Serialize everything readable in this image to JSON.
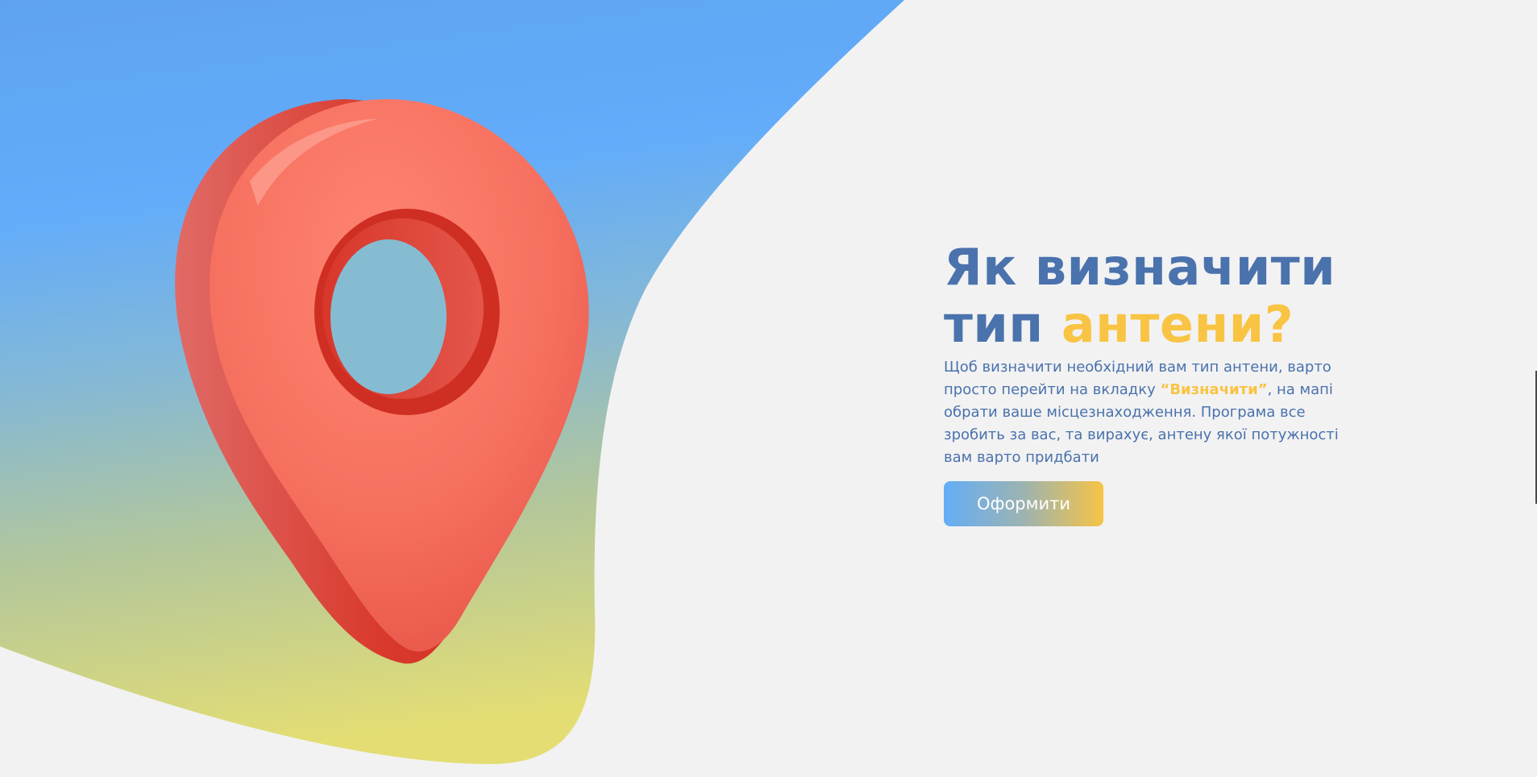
{
  "hero": {
    "title_line1": "Як визначити",
    "title_line2_prefix": "тип ",
    "title_line2_accent": "антени?",
    "description_before": "Щоб визначити необхідний вам тип антени, варто просто перейти на вкладку ",
    "description_highlight": "“Визначити”",
    "description_after": ", на мапі обрати ваше місцезнаходження. Програма все зробить за вас, та вирахує, антену якої потужності вам варто придбати",
    "cta_label": "Оформити"
  },
  "illustration": {
    "icon": "map-pin-icon"
  },
  "colors": {
    "primary_text": "#4a72ad",
    "accent": "#f9c443",
    "background": "#f2f2f2",
    "gradient_blue": "#63adf7",
    "gradient_yellow": "#f6c446",
    "pin_red": "#f06a5a"
  }
}
